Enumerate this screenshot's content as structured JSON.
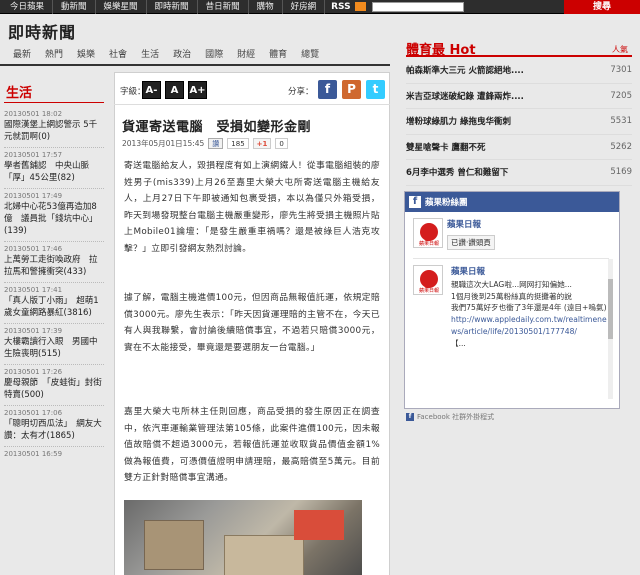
{
  "topnav": {
    "items": [
      "今日蘋果",
      "動新聞",
      "娛樂星聞",
      "即時新聞",
      "昔日新聞",
      "購物",
      "好房網"
    ],
    "rss": "RSS",
    "search_button": "搜尋"
  },
  "header": {
    "title": "即時新聞",
    "categories": [
      "最新",
      "熱門",
      "娛樂",
      "社會",
      "生活",
      "政治",
      "國際",
      "財經",
      "體育",
      "總覽"
    ]
  },
  "left": {
    "section_title": "生活",
    "items": [
      {
        "time": "20130501 18:02",
        "text": "國際漢堡上網認警示 5千元就罰啊(0)"
      },
      {
        "time": "20130501 17:57",
        "text": "學者舊鋪認　中央山脈「厚」45公里(82)"
      },
      {
        "time": "20130501 17:49",
        "text": "北婦中心花53億再造加8億　議員批「錢坑中心」(139)"
      },
      {
        "time": "20130501 17:46",
        "text": "上萬勞工走街喚政府　拉拉馬和警擁衝突(433)"
      },
      {
        "time": "20130501 17:41",
        "text": "「真人版丁小雨」　超萌1歲女童網路暴紅(3816)"
      },
      {
        "time": "20130501 17:39",
        "text": "大樓霸讀行入眼　男國中生險喪明(515)"
      },
      {
        "time": "20130501 17:26",
        "text": "慶母親節　「皮蛙街」封街特賣(500)"
      },
      {
        "time": "20130501 17:06",
        "text": "「聰明切西瓜法」　網友大讚：太有才(1865)"
      },
      {
        "time": "20130501 16:59",
        "text": ""
      }
    ]
  },
  "toolbar": {
    "font_label": "字級：",
    "font_buttons": [
      "A-",
      "A",
      "A+"
    ],
    "share_label": "分享：",
    "share_icons": [
      {
        "name": "facebook-icon",
        "glyph": "f",
        "color": "#3b5998"
      },
      {
        "name": "plurk-icon",
        "glyph": "P",
        "color": "#cf682f"
      },
      {
        "name": "twitter-icon",
        "glyph": "t",
        "color": "#33ccff"
      }
    ]
  },
  "article": {
    "title": "貨運寄送電腦　受損如變形金剛",
    "datetime": "2013年05月01日15:45",
    "like_label": "讚",
    "like_count": "185",
    "gplus_label": "+1",
    "gplus_count": "0",
    "paragraphs": [
      "寄送電腦給友人，毀損程度有如上演網鐵人！從事電腦組裝的廖姓男子(mis339)上月26至嘉里大榮大屯所寄送電腦主機給友人，上月27日下午即被通知包裹受損，本以為僅只外箱受損，昨天到場發現整台電腦主機嚴重變形，廖先生將受損主機照片貼上Mobile01論壇：「是發生嚴重車禍嗎？還是被綠巨人浩克攻擊？」立即引發網友熱烈討論。",
      "據了解，電腦主機進價100元，但因商品無報值託運，依規定賠償3000元。廖先生表示：「昨天因貨運理賠的主管不在，今天已有人與我聯繫，會討論後續賠償事宜，不過若只賠償3000元，實在不太能接受，畢竟還是要選朋友一台電腦。」",
      "嘉里大榮大屯所林主任則回應，商品受損的發生原因正在調查中，依汽車運輸業管理法第105條，此案件進價100元，因未報值故賠償不超過3000元，若報值託運並收取貨品價值金額1%做為報值費，可憑價值證明申請理賠，最高賠償至5萬元。目前雙方正針對賠償事宜溝通。"
    ]
  },
  "hot": {
    "title": "體育最 Hot",
    "unit": "人氣",
    "items": [
      {
        "text": "帕森斯準大三元 火箭認絕地....",
        "count": "7301"
      },
      {
        "text": "米吉亞球迷破紀錄 遭鋒兩炸....",
        "count": "7205"
      },
      {
        "text": "增粉球綠肌力 綠拖曳华衝刺",
        "count": "5531"
      },
      {
        "text": "雙星嗆聲卡 鷹翻不死",
        "count": "5262"
      },
      {
        "text": "6月李中選秀 曾仁和難留下",
        "count": "5169"
      }
    ]
  },
  "facebook": {
    "header": "蘋果粉絲團",
    "page_name": "蘋果日報",
    "like_button": "已讚·讚頭頁",
    "post_author": "蘋果日報",
    "post_lines": [
      "親職這次大LAG啦...网网打知偏她...",
      "1個月後到25萬粉絲真的挺攤著的說",
      "我們75萬好歹也衝了3年還是4年 (遠目+嗚氣)"
    ],
    "post_link": "http://www.appledaily.com.tw/realtimenews/article/life/20130501/177748/",
    "post_link_tail": "【...",
    "footer": "Facebook 社群外掛程式"
  }
}
